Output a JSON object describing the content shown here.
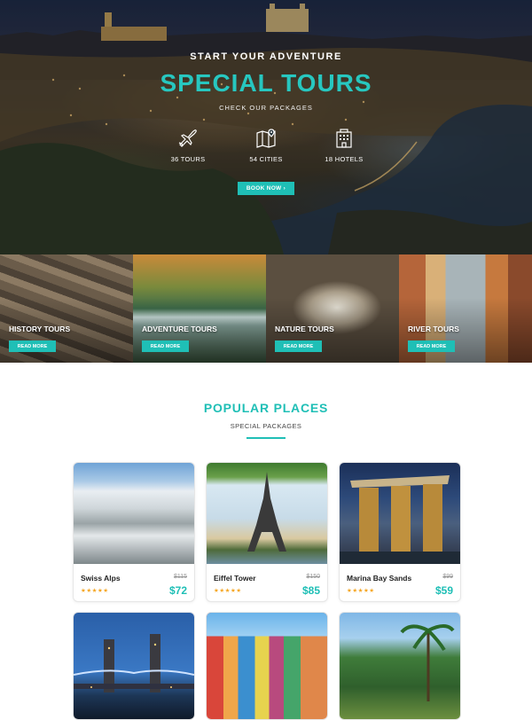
{
  "hero": {
    "eyebrow": "START YOUR ADVENTURE",
    "title": "SPECIAL TOURS",
    "subtitle": "CHECK OUR PACKAGES",
    "stats": [
      {
        "icon": "airplane-icon",
        "label": "36 TOURS"
      },
      {
        "icon": "map-pin-icon",
        "label": "54 CITIES"
      },
      {
        "icon": "hotel-building-icon",
        "label": "18 HOTELS"
      }
    ],
    "book_button": "BOOK NOW  ›"
  },
  "tours": [
    {
      "name": "HISTORY TOURS",
      "button": "READ MORE"
    },
    {
      "name": "ADVENTURE TOURS",
      "button": "READ MORE"
    },
    {
      "name": "NATURE TOURS",
      "button": "READ MORE"
    },
    {
      "name": "RIVER TOURS",
      "button": "READ MORE"
    }
  ],
  "popular": {
    "title": "POPULAR PLACES",
    "subtitle": "SPECIAL PACKAGES",
    "places": [
      {
        "name": "Swiss Alps",
        "old_price": "$115",
        "price": "$72",
        "rating": 5
      },
      {
        "name": "Eiffel Tower",
        "old_price": "$150",
        "price": "$85",
        "rating": 5
      },
      {
        "name": "Marina Bay Sands",
        "old_price": "$99",
        "price": "$59",
        "rating": 5
      }
    ],
    "next_row_images": [
      "tower-bridge-photo",
      "colorful-harbor-photo",
      "tropical-garden-photo"
    ]
  },
  "colors": {
    "accent": "#1fbfb6",
    "star": "#f5a623",
    "text_dark": "#222222"
  },
  "stars_text": "★★★★★"
}
